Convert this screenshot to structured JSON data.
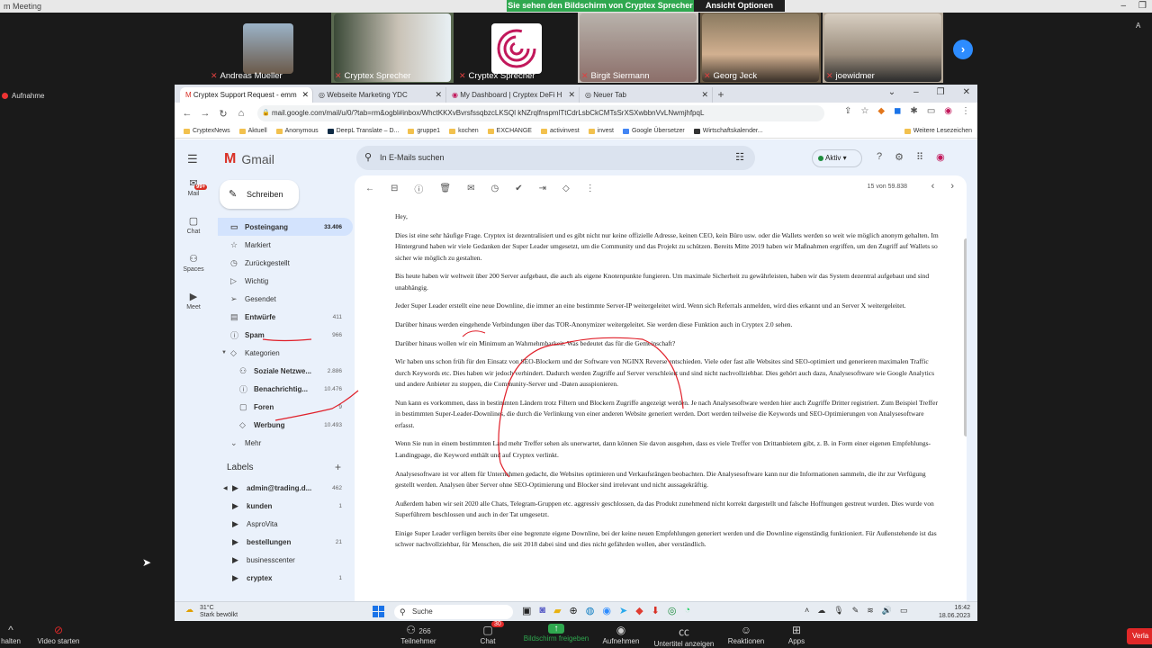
{
  "zoom": {
    "window_title": "m Meeting",
    "share_banner": "Sie sehen den Bildschirm von Cryptex Sprecher",
    "view_options": "Ansicht Optionen",
    "recording_label": "Aufnahme",
    "side_letter": "A",
    "participants": [
      "Andreas Mueller",
      "Cryptex Sprecher",
      "Cryptex Sprecher",
      "Birgit Siermann",
      "Georg Jeck",
      "joewidmer"
    ],
    "bottom": {
      "audio": "halten",
      "video": "Video starten",
      "participants_label": "Teilnehmer",
      "participants_count": "266",
      "chat_label": "Chat",
      "chat_badge": "30",
      "share_label": "Bildschirm freigeben",
      "record_label": "Aufnehmen",
      "captions_label": "Untertitel anzeigen",
      "reactions_label": "Reaktionen",
      "apps_label": "Apps",
      "end_label": "Verla"
    }
  },
  "browser": {
    "tabs": [
      {
        "label": "Cryptex Support Request - emm"
      },
      {
        "label": "Webseite Marketing YDC"
      },
      {
        "label": "My Dashboard | Cryptex DeFi H"
      },
      {
        "label": "Neuer Tab"
      }
    ],
    "url": "mail.google.com/mail/u/0/?tab=rm&ogbl#inbox/WhctKKXvBvrsfssqbzcLKSQl kNZrqlfnspmlTtCdrLsbCkCMTsSrXSXwbbnVvLNwmjhfpqL",
    "bookmarks": [
      "CryptexNews",
      "Aktuell",
      "Anonymous",
      "DeepL Translate – D...",
      "gruppe1",
      "kochen",
      "EXCHANGE",
      "activinvest",
      "invest",
      "Google Übersetzer",
      "Wirtschaftskalender...",
      "Weitere Lesezeichen"
    ]
  },
  "gmail": {
    "logo": "Gmail",
    "search_placeholder": "In E-Mails suchen",
    "status": "Aktiv",
    "compose": "Schreiben",
    "rail": [
      {
        "label": "Mail",
        "badge": "99+"
      },
      {
        "label": "Chat"
      },
      {
        "label": "Spaces"
      },
      {
        "label": "Meet"
      }
    ],
    "nav": [
      {
        "label": "Posteingang",
        "count": "33.406"
      },
      {
        "label": "Markiert",
        "count": ""
      },
      {
        "label": "Zurückgestellt",
        "count": ""
      },
      {
        "label": "Wichtig",
        "count": ""
      },
      {
        "label": "Gesendet",
        "count": ""
      },
      {
        "label": "Entwürfe",
        "count": "411"
      },
      {
        "label": "Spam",
        "count": "966"
      },
      {
        "label": "Kategorien",
        "count": ""
      },
      {
        "label": "Soziale Netzwe...",
        "count": "2.886"
      },
      {
        "label": "Benachrichtig...",
        "count": "10.476"
      },
      {
        "label": "Foren",
        "count": "9"
      },
      {
        "label": "Werbung",
        "count": "10.493"
      },
      {
        "label": "Mehr",
        "count": ""
      }
    ],
    "labels_title": "Labels",
    "labels": [
      {
        "label": "admin@trading.d...",
        "count": "462"
      },
      {
        "label": "kunden",
        "count": "1"
      },
      {
        "label": "AsproVita",
        "count": ""
      },
      {
        "label": "bestellungen",
        "count": "21"
      },
      {
        "label": "businesscenter",
        "count": ""
      },
      {
        "label": "cryptex",
        "count": "1"
      }
    ],
    "pager": "15 von 59.838",
    "body": [
      "Hey,",
      "Dies ist eine sehr häufige Frage. Cryptex ist dezentralisiert und es gibt nicht nur keine offizielle Adresse, keinen CEO, kein Büro usw. oder die Wallets werden so weit wie möglich anonym gehalten. Im Hintergrund haben wir viele Gedanken der Super Leader umgesetzt, um die Community und das Projekt zu schützen. Bereits Mitte 2019 haben wir Maßnahmen ergriffen, um den Zugriff auf Wallets so sicher wie möglich zu gestalten.",
      "Bis heute haben wir weltweit über 200 Server aufgebaut, die auch als eigene Knotenpunkte fungieren. Um maximale Sicherheit zu gewährleisten, haben wir das System dezentral aufgebaut und sind unabhängig.",
      "Jeder Super Leader erstellt eine neue Downline, die immer an eine bestimmte Server-IP weitergeleitet wird. Wenn sich Referrals anmelden, wird dies erkannt und an Server X weitergeleitet.",
      "Darüber hinaus werden eingehende Verbindungen über das TOR-Anonymizer weitergeleitet. Sie werden diese Funktion auch in Cryptex 2.0 sehen.",
      "Darüber hinaus wollen wir ein Minimum an Wahrnehmbarkeit. Was bedeutet das für die Gemeinschaft?",
      "Wir haben uns schon früh für den Einsatz von SEO-Blockern und der Software von NGINX Reverse entschieden. Viele oder fast alle Websites sind SEO-optimiert und generieren maximalen Traffic durch Keywords etc. Dies haben wir jedoch verhindert. Dadurch werden Zugriffe auf Server verschleiert und sind nicht nachvollziehbar. Dies gehört auch dazu, Analysesoftware wie Google Analytics und andere Anbieter zu stoppen, die Community-Server und -Daten ausspionieren.",
      "Nun kann es vorkommen, dass in bestimmten Ländern trotz Filtern und Blockern Zugriffe angezeigt werden. Je nach Analysesoftware werden hier auch Zugriffe Dritter registriert. Zum Beispiel Treffer in bestimmten Super-Leader-Downlines, die durch die Verlinkung von einer anderen Website generiert werden. Dort werden teilweise die Keywords und SEO-Optimierungen von Analysesoftware erfasst.",
      "Wenn Sie nun in einem bestimmten Land mehr Treffer sehen als unerwartet, dann können Sie davon ausgehen, dass es viele Treffer von Drittanbietern gibt, z. B. in Form einer eigenen Empfehlungs-Landingpage, die Keyword enthält und auf Cryptex verlinkt.",
      "Analysesoftware ist vor allem für Unternehmen gedacht, die Websites optimieren und Verkaufsrängen beobachten. Die Analysesoftware kann nur die Informationen sammeln, die ihr zur Verfügung gestellt werden. Analysen über Server ohne SEO-Optimierung und Blocker sind irrelevant und nicht aussagekräftig.",
      "Außerdem haben wir seit 2020 alle Chats, Telegram-Gruppen etc. aggressiv geschlossen, da das Produkt zunehmend nicht korrekt dargestellt und falsche Hoffnungen gestreut wurden. Dies wurde von Superführern beschlossen und auch in der Tat umgesetzt.",
      "Einige Super Leader verfügen bereits über eine begrenzte eigene Downline, bei der keine neuen Empfehlungen generiert werden und die Downline eigenständig funktioniert. Für Außenstehende ist das schwer nachvollziehbar, für Menschen, die seit 2018 dabei sind und dies nicht gefährden wollen, aber verständlich."
    ]
  },
  "taskbar": {
    "temp": "31°C",
    "weather": "Stark bewölkt",
    "search": "Suche",
    "time": "16:42",
    "date": "18.06.2023"
  }
}
